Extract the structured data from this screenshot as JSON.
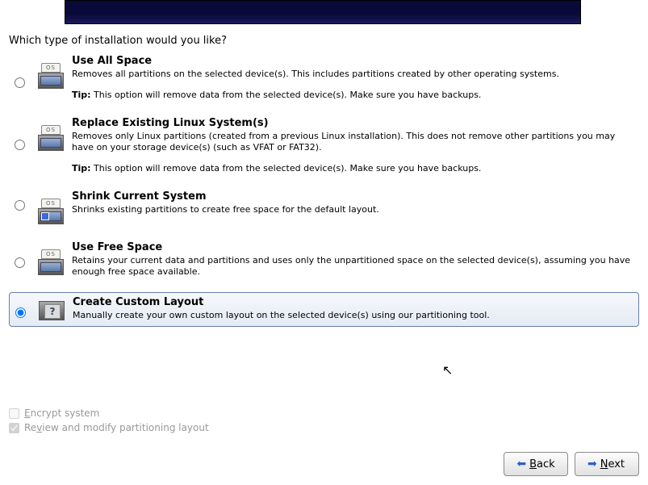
{
  "prompt": "Which type of installation would you like?",
  "options": [
    {
      "title": "Use All Space",
      "desc": "Removes all partitions on the selected device(s).  This includes partitions created by other operating systems.",
      "tip_label": "Tip:",
      "tip": "This option will remove data from the selected device(s).  Make sure you have backups.",
      "os_label": "OS"
    },
    {
      "title": "Replace Existing Linux System(s)",
      "desc": "Removes only Linux partitions (created from a previous Linux installation).  This does not remove other partitions you may have on your storage device(s) (such as VFAT or FAT32).",
      "tip_label": "Tip:",
      "tip": "This option will remove data from the selected device(s).  Make sure you have backups.",
      "os_label": "OS"
    },
    {
      "title": "Shrink Current System",
      "desc": "Shrinks existing partitions to create free space for the default layout.",
      "os_label": "OS"
    },
    {
      "title": "Use Free Space",
      "desc": "Retains your current data and partitions and uses only the unpartitioned space on the selected device(s), assuming you have enough free space available.",
      "os_label": "OS"
    },
    {
      "title": "Create Custom Layout",
      "desc": "Manually create your own custom layout on the selected device(s) using our partitioning tool."
    }
  ],
  "checks": {
    "encrypt_pre": "E",
    "encrypt_rest": "ncrypt system",
    "review_pre": "Re",
    "review_u": "v",
    "review_rest": "iew and modify partitioning layout"
  },
  "buttons": {
    "back_u": "B",
    "back_rest": "ack",
    "next_u": "N",
    "next_rest": "ext"
  }
}
